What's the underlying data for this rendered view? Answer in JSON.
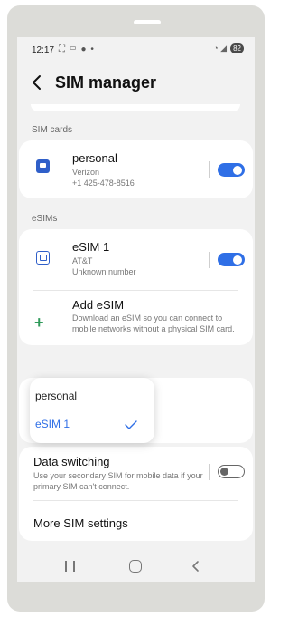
{
  "status_bar": {
    "time": "12:17",
    "left_icons": "⛶ ▭ ● •",
    "right_icons": "◔ ◢",
    "battery": "82"
  },
  "header": {
    "title": "SIM manager"
  },
  "sim_cards": {
    "section_label": "SIM cards",
    "items": [
      {
        "name": "personal",
        "carrier": "Verizon",
        "number": "+1 425-478-8516",
        "enabled": true
      }
    ]
  },
  "esims": {
    "section_label": "eSIMs",
    "items": [
      {
        "name": "eSIM 1",
        "carrier": "AT&T",
        "number": "Unknown number",
        "enabled": true
      }
    ],
    "add": {
      "title": "Add eSIM",
      "description": "Download an eSIM so you can connect to mobile networks without a physical SIM card."
    }
  },
  "popup": {
    "options": [
      {
        "label": "personal",
        "selected": false
      },
      {
        "label": "eSIM 1",
        "selected": true
      }
    ]
  },
  "settings": {
    "data_switching": {
      "title": "Data switching",
      "description": "Use your secondary SIM for mobile data if your primary SIM can't connect.",
      "enabled": false
    },
    "more": {
      "title": "More SIM settings"
    }
  },
  "colors": {
    "accent": "#2f6fe6",
    "sim_icon": "#2f5fc9",
    "add_icon": "#2f9a5a",
    "screen_bg": "#f2f2f2"
  },
  "icons": {
    "back": "chevron-left-icon",
    "sim": "sim-card-icon",
    "add": "plus-icon",
    "check": "check-icon"
  }
}
